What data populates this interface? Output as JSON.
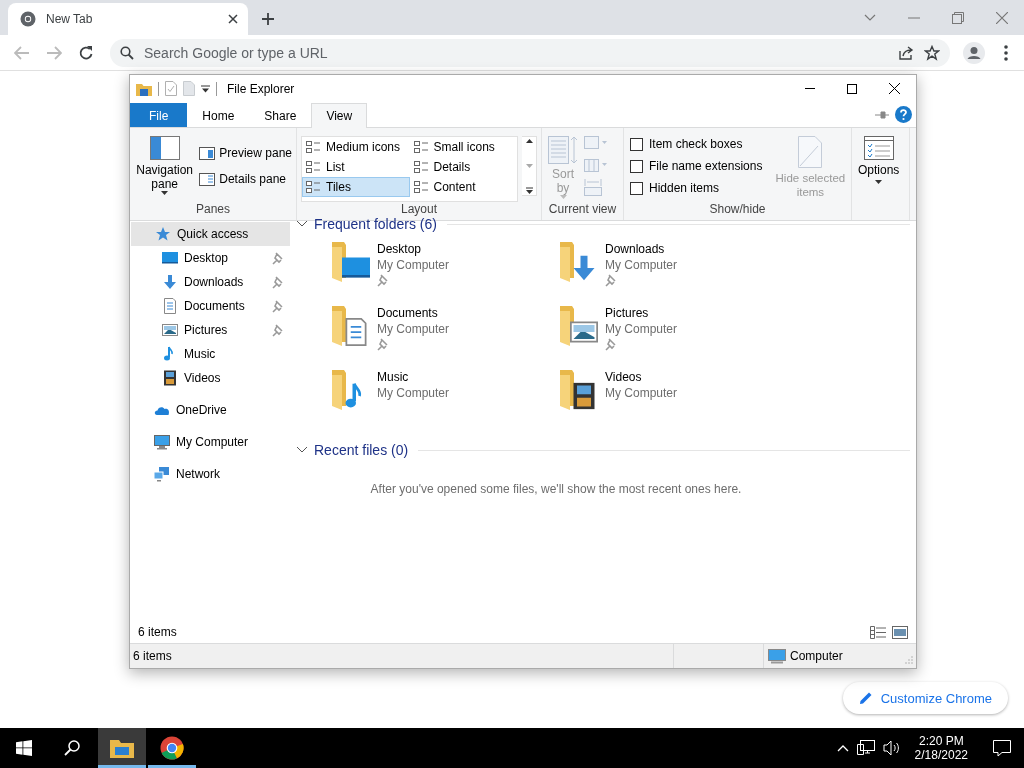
{
  "browser": {
    "tab": {
      "title": "New Tab"
    },
    "address_bar": {
      "placeholder": "Search Google or type a URL"
    },
    "customize_button": "Customize Chrome"
  },
  "explorer": {
    "title": "File Explorer",
    "ribbon_tabs": [
      {
        "label": "File",
        "kind": "menu",
        "selected": false
      },
      {
        "label": "Home",
        "kind": "tab",
        "selected": false
      },
      {
        "label": "Share",
        "kind": "tab",
        "selected": false
      },
      {
        "label": "View",
        "kind": "tab",
        "selected": true
      }
    ],
    "ribbon": {
      "panes": {
        "label": "Panes",
        "navigation_pane": "Navigation pane",
        "preview_pane": "Preview pane",
        "details_pane": "Details pane"
      },
      "layout": {
        "label": "Layout",
        "options": [
          {
            "label": "Medium icons",
            "selected": false
          },
          {
            "label": "Small icons",
            "selected": false
          },
          {
            "label": "List",
            "selected": false
          },
          {
            "label": "Details",
            "selected": false
          },
          {
            "label": "Tiles",
            "selected": true
          },
          {
            "label": "Content",
            "selected": false
          }
        ]
      },
      "current_view": {
        "label": "Current view",
        "sort_by": "Sort by",
        "disabled": true
      },
      "show_hide": {
        "label": "Show/hide",
        "checkboxes": [
          {
            "label": "Item check boxes",
            "checked": false
          },
          {
            "label": "File name extensions",
            "checked": false
          },
          {
            "label": "Hidden items",
            "checked": false
          }
        ],
        "hide_selected": {
          "label": "Hide selected items",
          "disabled": true
        }
      },
      "options": {
        "label": "Options"
      }
    },
    "navigation": [
      {
        "label": "Quick access",
        "kind": "star",
        "selected": true,
        "children": [
          {
            "label": "Desktop",
            "kind": "desktop",
            "pinned": true,
            "selected": false
          },
          {
            "label": "Downloads",
            "kind": "download",
            "pinned": true,
            "selected": false
          },
          {
            "label": "Documents",
            "kind": "document",
            "pinned": true,
            "selected": false
          },
          {
            "label": "Pictures",
            "kind": "picture",
            "pinned": true,
            "selected": false
          },
          {
            "label": "Music",
            "kind": "music",
            "pinned": false,
            "selected": false
          },
          {
            "label": "Videos",
            "kind": "video",
            "pinned": false,
            "selected": false
          }
        ]
      },
      {
        "label": "OneDrive",
        "kind": "cloud",
        "selected": false
      },
      {
        "label": "My Computer",
        "kind": "computer",
        "selected": false
      },
      {
        "label": "Network",
        "kind": "network",
        "selected": false
      }
    ],
    "content": {
      "frequent": {
        "heading": "Frequent folders (6)",
        "expanded": true,
        "folders": [
          {
            "name": "Desktop",
            "location": "My Computer",
            "kind": "desktop",
            "pinned": true
          },
          {
            "name": "Downloads",
            "location": "My Computer",
            "kind": "download",
            "pinned": true
          },
          {
            "name": "Documents",
            "location": "My Computer",
            "kind": "document",
            "pinned": true
          },
          {
            "name": "Pictures",
            "location": "My Computer",
            "kind": "picture",
            "pinned": true
          },
          {
            "name": "Music",
            "location": "My Computer",
            "kind": "music",
            "pinned": false
          },
          {
            "name": "Videos",
            "location": "My Computer",
            "kind": "video",
            "pinned": false
          }
        ]
      },
      "recent": {
        "heading": "Recent files (0)",
        "expanded": true,
        "empty_message": "After you've opened some files, we'll show the most recent ones here."
      },
      "item_count": "6 items"
    },
    "status_bar": {
      "items": "6 items",
      "location": "Computer"
    }
  },
  "taskbar": {
    "apps": [
      {
        "kind": "explorer",
        "active": true
      },
      {
        "kind": "chrome",
        "active": false
      }
    ],
    "time": "2:20 PM",
    "date": "2/18/2022"
  }
}
